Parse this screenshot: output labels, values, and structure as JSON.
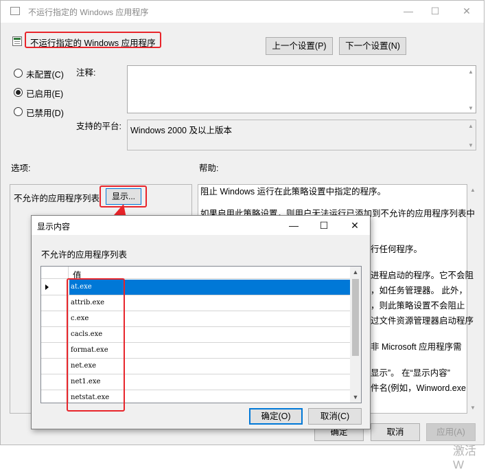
{
  "main_window": {
    "title": "不运行指定的 Windows 应用程序",
    "policy_title": "不运行指定的 Windows 应用程序",
    "prev_setting": "上一个设置(P)",
    "next_setting": "下一个设置(N)",
    "radio_options": [
      {
        "label": "未配置(C)",
        "checked": false
      },
      {
        "label": "已启用(E)",
        "checked": true
      },
      {
        "label": "已禁用(D)",
        "checked": false
      }
    ],
    "comment_label": "注释:",
    "comment_value": "",
    "platform_label": "支持的平台:",
    "platform_value": "Windows 2000 及以上版本",
    "options_label": "选项:",
    "help_label": "帮助:",
    "disallowed_list_label": "不允许的应用程序列表",
    "show_button": "显示...",
    "help_lines": [
      "阻止 Windows 运行在此策略设置中指定的程序。",
      "",
      "如果启用此策略设置，则用户无法运行已添加到不允许的应用程序列表中",
      "的程序。",
      "",
      "行任何程序。",
      "",
      "进程启动的程序。它不会阻",
      "，如任务管理器。 此外，",
      "，则此策略设置不会阻止",
      "过文件资源管理器启动程序",
      "",
      "非 Microsoft 应用程序需",
      "",
      "显示”。 在“显示内容”",
      "件名(例如，Winword.exe"
    ],
    "ok": "确定",
    "cancel": "取消",
    "apply": "应用(A)",
    "watermark": "激活 W"
  },
  "dialog": {
    "title": "显示内容",
    "list_label": "不允许的应用程序列表",
    "column_header": "值",
    "rows": [
      "at.exe",
      "attrib.exe",
      "c.exe",
      "cacls.exe",
      "format.exe",
      "net.exe",
      "net1.exe",
      "netstat.exe"
    ],
    "selected_index": 0,
    "ok": "确定(O)",
    "cancel": "取消(C)"
  },
  "colors": {
    "highlight": "#0078d7",
    "annotation_red": "#e8242a",
    "window_bg": "#f0f0f0"
  }
}
